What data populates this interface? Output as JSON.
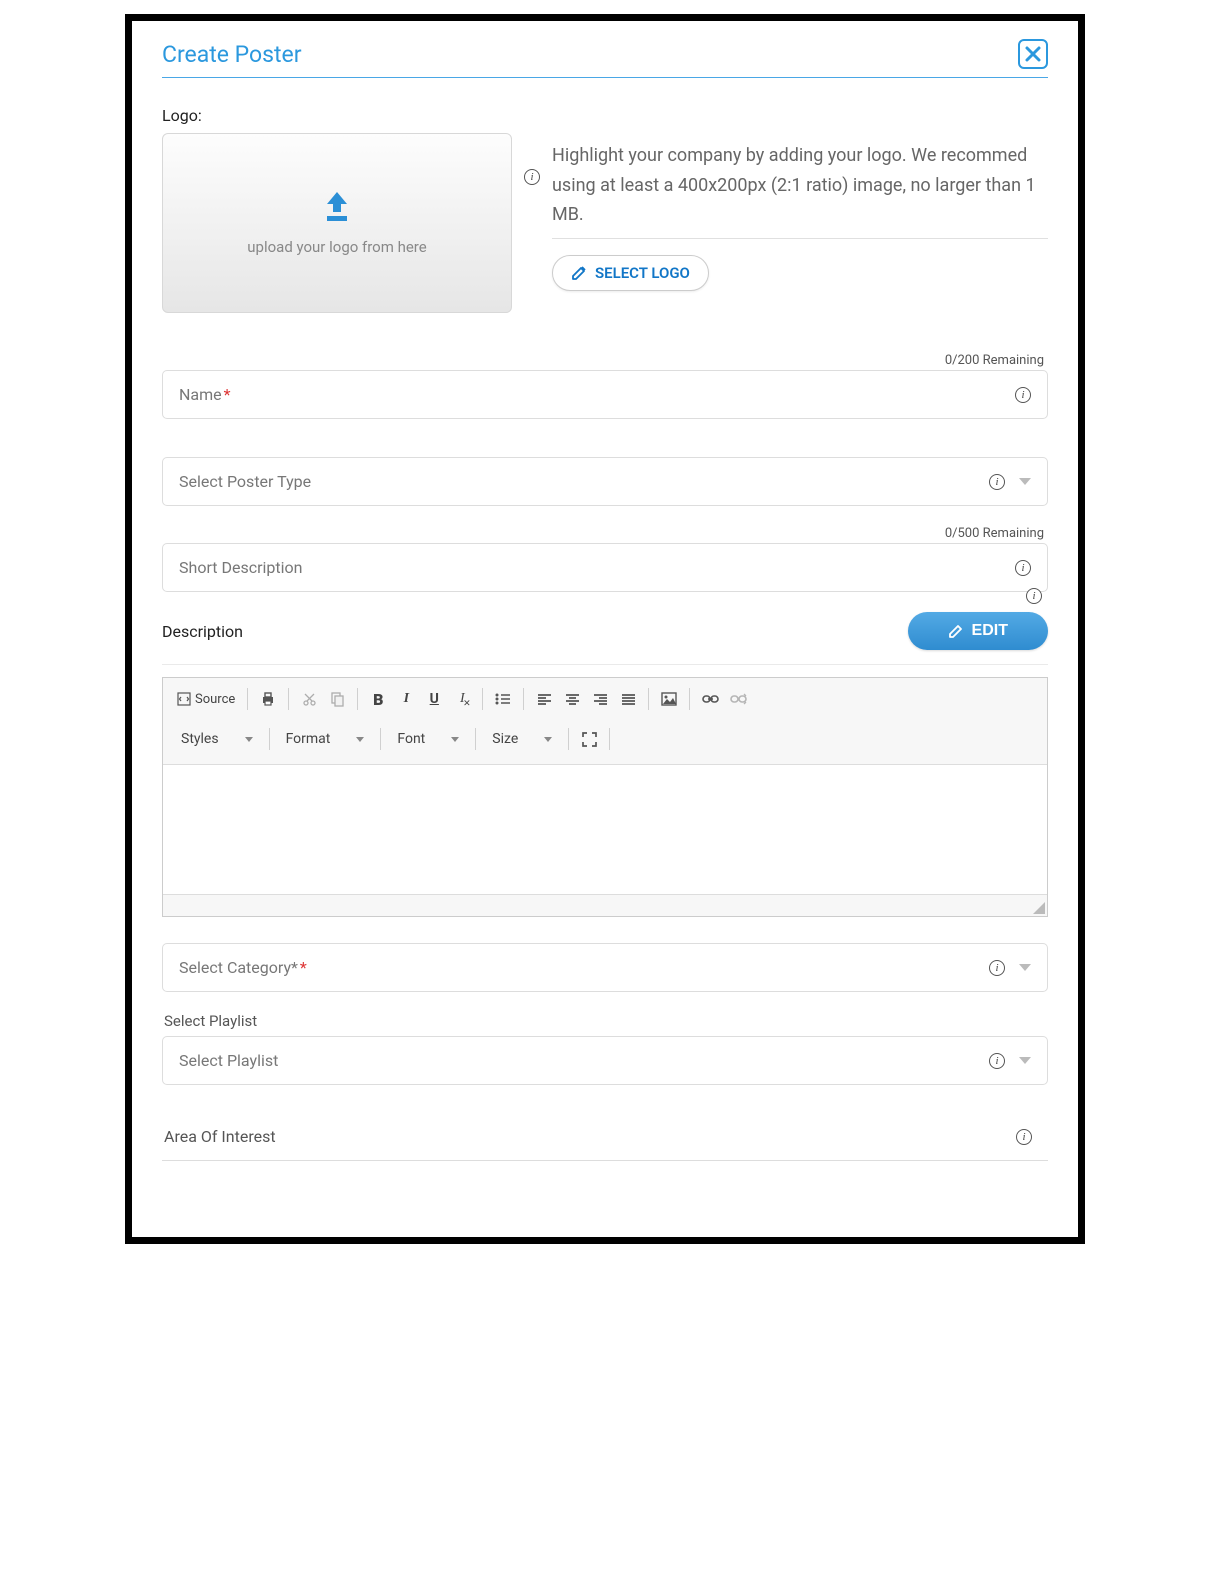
{
  "header": {
    "title": "Create Poster"
  },
  "logo": {
    "section_label": "Logo:",
    "upload_hint": "upload your logo from here",
    "help_text": "Highlight your company by adding your logo. We recommed using at least a 400x200px (2:1 ratio) image, no larger than 1 MB.",
    "select_button": "SELECT LOGO"
  },
  "name_field": {
    "placeholder": "Name",
    "required_mark": "*",
    "counter": "0/200 Remaining"
  },
  "poster_type": {
    "placeholder": "Select Poster Type"
  },
  "short_desc": {
    "placeholder": "Short Description",
    "counter": "0/500 Remaining"
  },
  "description": {
    "label": "Description",
    "edit_button": "EDIT"
  },
  "editor": {
    "source_label": "Source",
    "dropdowns": {
      "styles": "Styles",
      "format": "Format",
      "font": "Font",
      "size": "Size"
    }
  },
  "category": {
    "placeholder": "Select Category*",
    "required_mark": "*"
  },
  "playlist": {
    "label": "Select Playlist",
    "placeholder": "Select Playlist"
  },
  "area_of_interest": {
    "placeholder": "Area Of Interest"
  }
}
